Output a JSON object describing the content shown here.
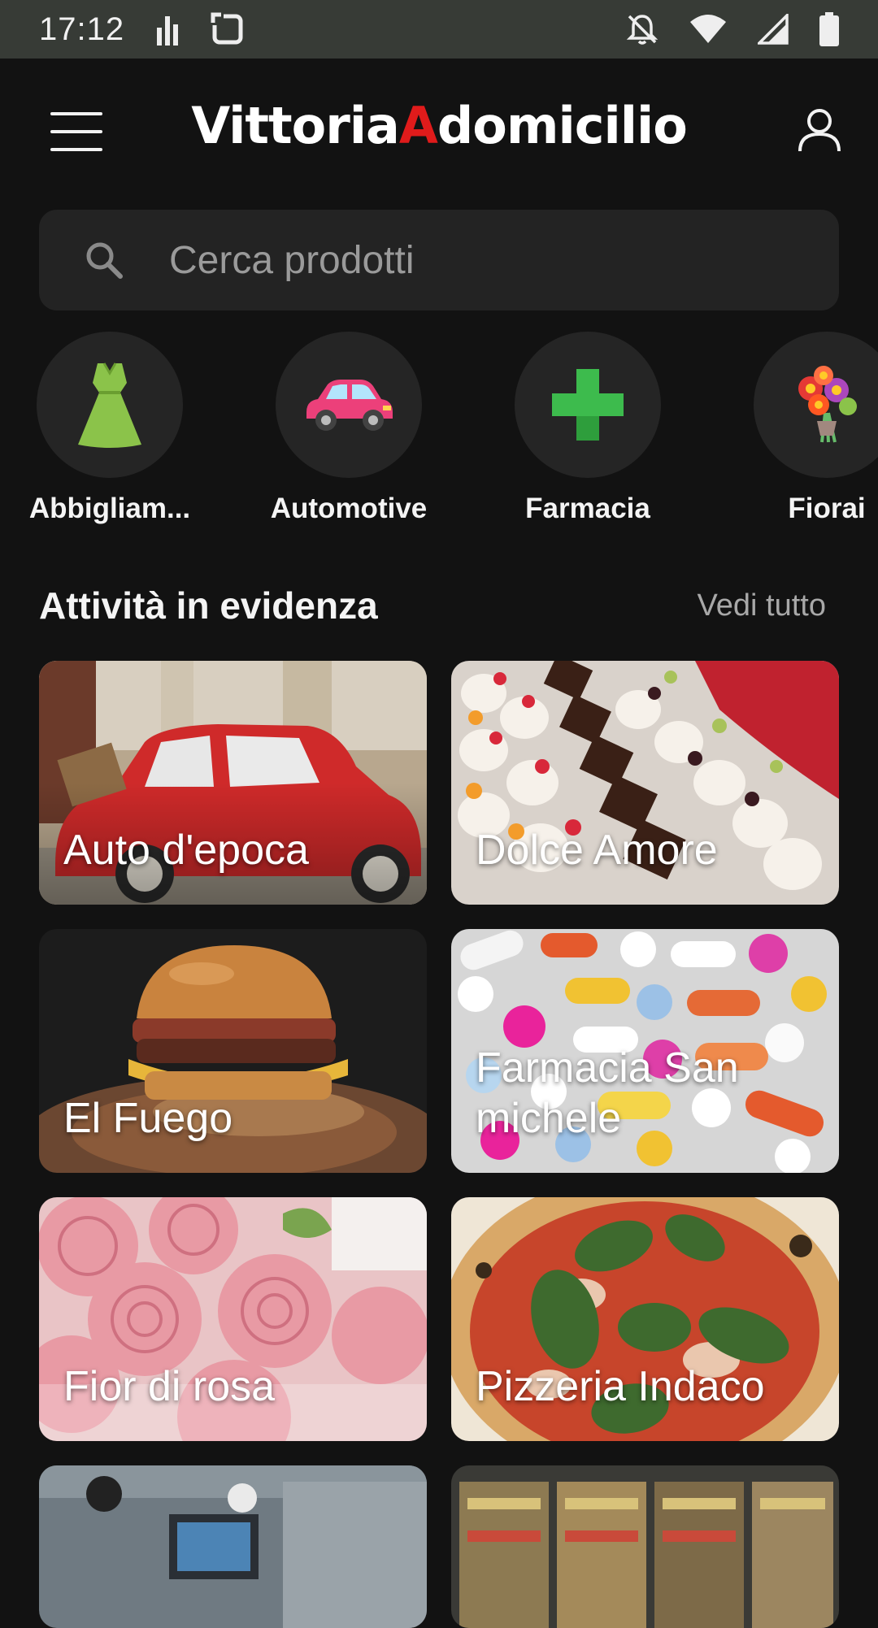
{
  "status_bar": {
    "time": "17:12",
    "icons": [
      "signal-bars-icon",
      "screen-rotate-icon",
      "notifications-off-icon",
      "wifi-icon",
      "cell-signal-icon",
      "battery-icon"
    ],
    "background": "#373b36"
  },
  "app_bar": {
    "logo_part1": "Vittoria",
    "logo_part2": "A",
    "logo_part3": "domicilio",
    "logo_accent": "#e01b1b",
    "menu_icon": "hamburger-menu-icon",
    "user_icon": "user-profile-icon"
  },
  "search": {
    "placeholder": "Cerca prodotti",
    "icon": "search-icon"
  },
  "categories": [
    {
      "label": "Abbigliam...",
      "icon": "dress-icon"
    },
    {
      "label": "Automotive",
      "icon": "car-icon"
    },
    {
      "label": "Farmacia",
      "icon": "pharmacy-cross-icon"
    },
    {
      "label": "Fiorai",
      "icon": "flower-bouquet-icon"
    }
  ],
  "featured": {
    "title": "Attività in evidenza",
    "see_all": "Vedi tutto",
    "cards": [
      {
        "label": "Auto d'epoca"
      },
      {
        "label": "Dolce Amore"
      },
      {
        "label": "El Fuego"
      },
      {
        "label": "Farmacia San michele"
      },
      {
        "label": "Fior di rosa"
      },
      {
        "label": "Pizzeria Indaco"
      }
    ]
  },
  "colors": {
    "background": "#121212",
    "surface": "#232323",
    "category_circle": "#252525"
  }
}
